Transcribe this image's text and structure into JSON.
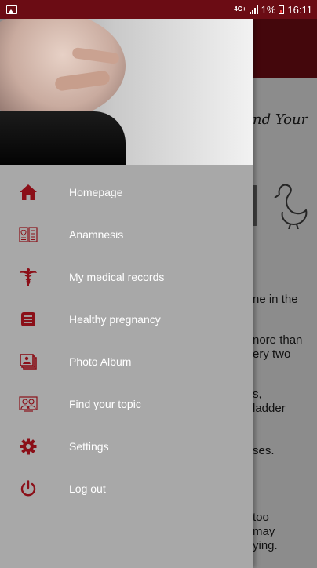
{
  "status_bar": {
    "network": "4G+",
    "battery_percent": "1%",
    "time": "16:11",
    "colors": {
      "background": "#6b0c14",
      "text": "#ffffff"
    }
  },
  "drawer": {
    "header_image": "pregnant-belly-photo",
    "items": [
      {
        "label": "Homepage",
        "icon": "home-icon"
      },
      {
        "label": "Anamnesis",
        "icon": "anamnesis-icon"
      },
      {
        "label": "My medical records",
        "icon": "caduceus-icon"
      },
      {
        "label": "Healthy pregnancy",
        "icon": "document-icon"
      },
      {
        "label": "Photo Album",
        "icon": "photo-album-icon"
      },
      {
        "label": "Find your topic",
        "icon": "people-icon"
      },
      {
        "label": "Settings",
        "icon": "gear-icon"
      },
      {
        "label": "Log out",
        "icon": "power-icon"
      }
    ],
    "colors": {
      "background": "#a8a8a8",
      "icon": "#8b0f18",
      "label": "#ffffff"
    }
  },
  "background_content": {
    "heading_fragment": "nd Your",
    "text_fragments": [
      "ne in the",
      "nore than",
      "ery two",
      "s,",
      "ladder",
      "ses.",
      "too",
      "may",
      "ying."
    ]
  }
}
